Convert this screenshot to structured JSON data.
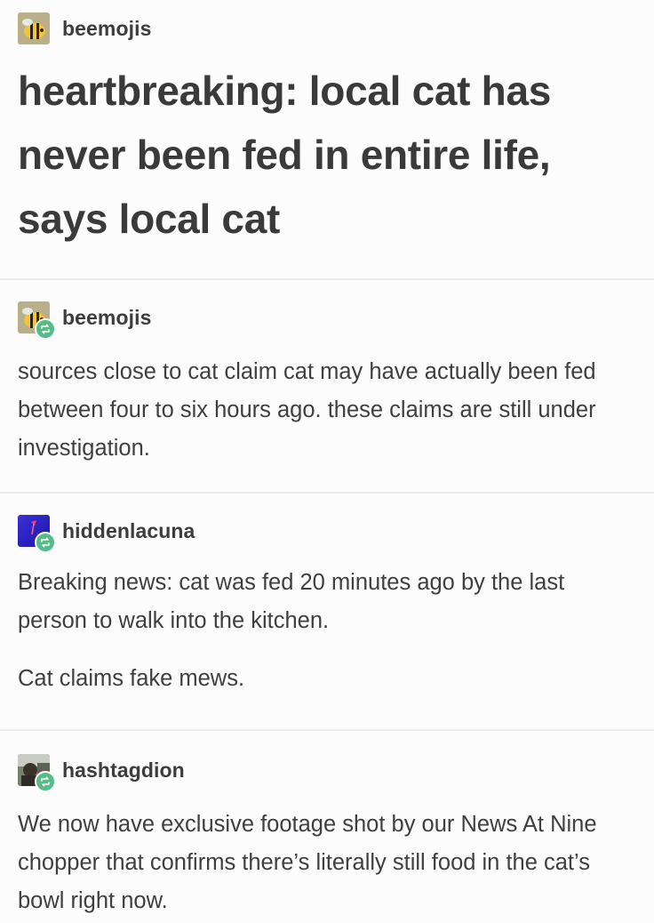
{
  "posts": [
    {
      "username": "beemojis",
      "reblog": false,
      "headline": "heartbreaking: local cat has never been fed in entire life, says local cat"
    },
    {
      "username": "beemojis",
      "reblog": true,
      "text": "sources close to cat claim cat may have actually been fed between four to six hours ago. these claims are still under investigation."
    },
    {
      "username": "hiddenlacuna",
      "reblog": true,
      "paragraphs": [
        "Breaking news: cat was fed 20 minutes ago by the last person to walk into the kitchen.",
        "Cat claims fake mews."
      ]
    },
    {
      "username": "hashtagdion",
      "reblog": true,
      "text": "We now have exclusive footage shot by our News At Nine chopper that confirms there’s literally still food in the cat’s bowl right now."
    }
  ],
  "icons": {
    "bee_avatar": "bee-avatar-icon",
    "lacuna_avatar": "hiddenlacuna-avatar-icon",
    "dion_avatar": "hashtagdion-avatar-icon",
    "reblog": "reblog-icon"
  },
  "colors": {
    "background": "#fcfcfc",
    "text": "#3a3a3a",
    "divider": "#ececec",
    "reblog_badge": "#56bc8a"
  }
}
